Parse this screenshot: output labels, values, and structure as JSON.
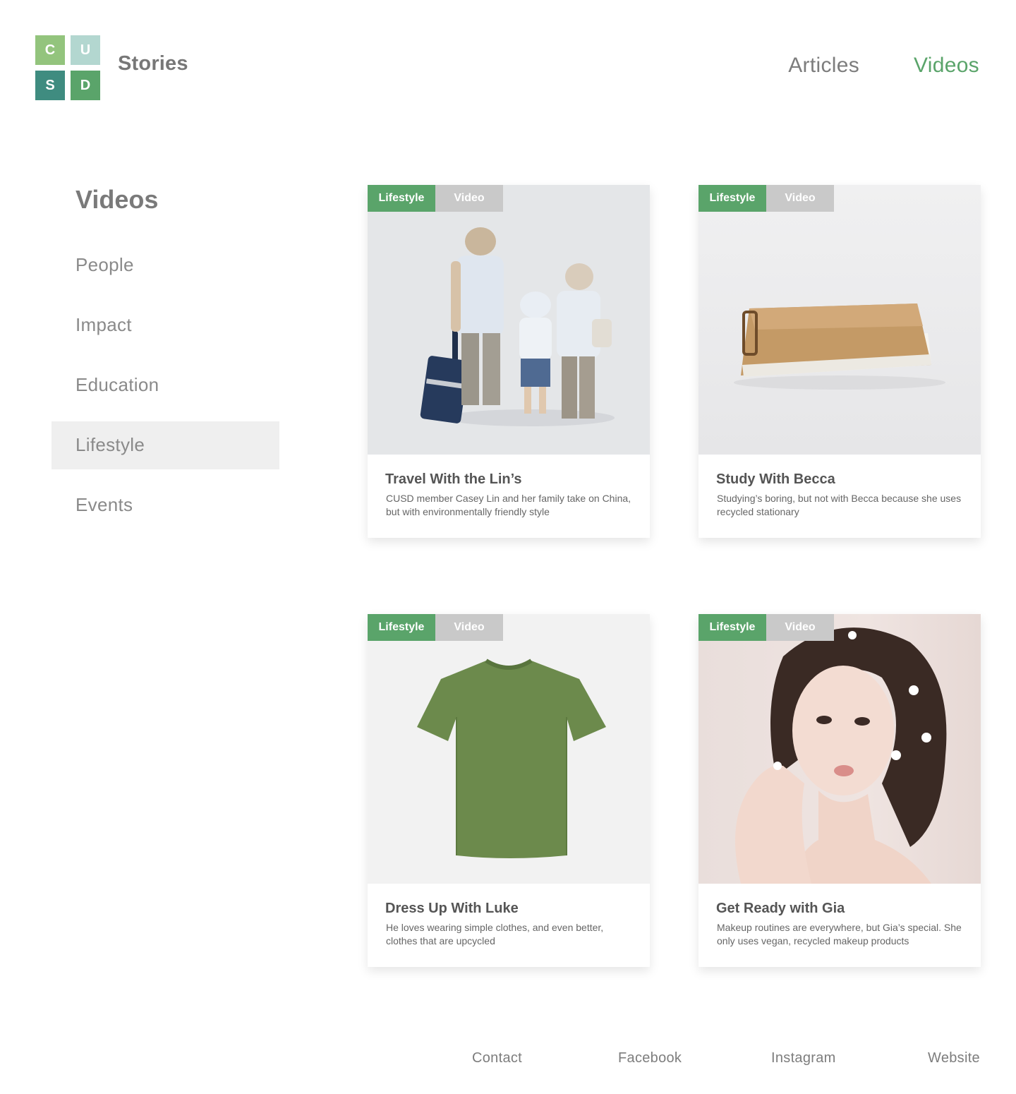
{
  "logo": {
    "letters": [
      "C",
      "U",
      "S",
      "D"
    ]
  },
  "brand": "Stories",
  "topnav": {
    "articles": "Articles",
    "videos": "Videos"
  },
  "sidebar": {
    "title": "Videos",
    "items": [
      {
        "label": "People"
      },
      {
        "label": "Impact"
      },
      {
        "label": "Education"
      },
      {
        "label": "Lifestyle"
      },
      {
        "label": "Events"
      }
    ]
  },
  "cards": [
    {
      "category": "Lifestyle",
      "type": "Video",
      "title": "Travel With the Lin’s",
      "desc": "CUSD member Casey Lin and her family take on China, but with environmentally friendly style"
    },
    {
      "category": "Lifestyle",
      "type": "Video",
      "title": "Study With Becca",
      "desc": "Studying’s boring, but not with Becca because she uses recycled stationary"
    },
    {
      "category": "Lifestyle",
      "type": "Video",
      "title": "Dress Up With Luke",
      "desc": "He loves wearing simple clothes, and even better, clothes that are upcycled"
    },
    {
      "category": "Lifestyle",
      "type": "Video",
      "title": "Get Ready with Gia",
      "desc": "Makeup routines are everywhere, but Gia’s special. She only uses vegan, recycled makeup products"
    }
  ],
  "footer": {
    "contact": "Contact",
    "facebook": "Facebook",
    "instagram": "Instagram",
    "website": "Website"
  },
  "colors": {
    "accent": "#5aa46a",
    "tag_gray": "#c9c9c9",
    "active_bg": "#efefef"
  }
}
